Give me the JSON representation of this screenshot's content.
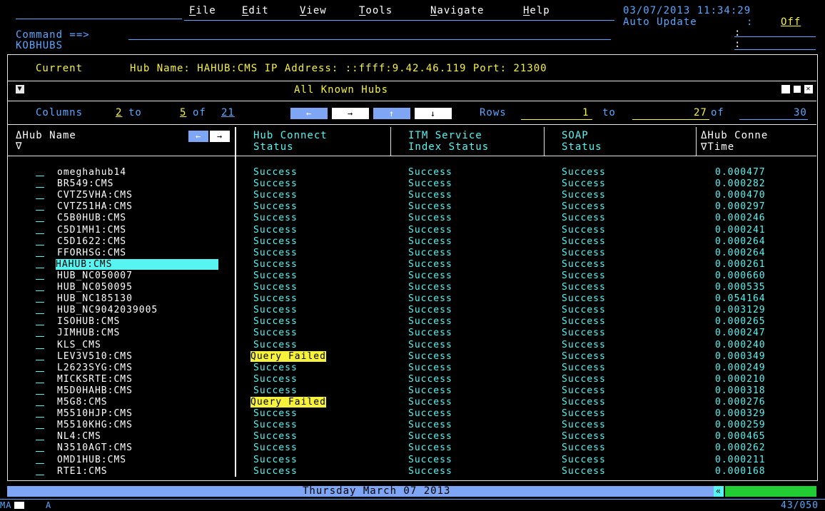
{
  "menu": {
    "items": [
      {
        "label": "File",
        "u": "F"
      },
      {
        "label": "Edit",
        "u": "E"
      },
      {
        "label": "View",
        "u": "V"
      },
      {
        "label": "Tools",
        "u": "T"
      },
      {
        "label": "Navigate",
        "u": "N"
      },
      {
        "label": "Help",
        "u": "H"
      }
    ],
    "datetime": "03/07/2013 11:34:29",
    "auto_update_label": "Auto Update",
    "auto_update_sep": ":",
    "auto_update_value": "Off",
    "colon": ":"
  },
  "command": {
    "label": "Command ==>",
    "value": ""
  },
  "panel_id": "KOBHUBS",
  "current": {
    "label": "Current",
    "text": "Hub Name: HAHUB:CMS IP Address: ::ffff:9.42.46.119 Port: 21300"
  },
  "window": {
    "title": "All Known Hubs",
    "columns_label": "Columns",
    "col_from": "2",
    "col_to_label": "to",
    "col_to": "5",
    "col_of_label": "of",
    "col_total": "21",
    "rows_label": "Rows",
    "row_from": "1",
    "row_to_label": "to",
    "row_to": "27",
    "row_of_label": "of",
    "row_total": "30",
    "left_arrow": "←",
    "right_arrow": "→",
    "up_arrow": "↑",
    "down_arrow": "↓"
  },
  "headers": {
    "hub_name": "ΔHub Name",
    "hub_name_sort": "∇",
    "hub_connect_1": "Hub Connect",
    "hub_connect_2": "Status",
    "itm_1": "ITM Service",
    "itm_2": "Index Status",
    "soap_1": "SOAP",
    "soap_2": "Status",
    "time_1": "ΔHub Conne",
    "time_2": "∇Time"
  },
  "rows": [
    {
      "name": "omeghahub14",
      "connect": "Success",
      "itm": "Success",
      "soap": "Success",
      "time": "0.000477"
    },
    {
      "name": "BR549:CMS",
      "connect": "Success",
      "itm": "Success",
      "soap": "Success",
      "time": "0.000282"
    },
    {
      "name": "CVTZ5VHA:CMS",
      "connect": "Success",
      "itm": "Success",
      "soap": "Success",
      "time": "0.000470"
    },
    {
      "name": "CVTZ51HA:CMS",
      "connect": "Success",
      "itm": "Success",
      "soap": "Success",
      "time": "0.000297"
    },
    {
      "name": "C5B0HUB:CMS",
      "connect": "Success",
      "itm": "Success",
      "soap": "Success",
      "time": "0.000246"
    },
    {
      "name": "C5D1MH1:CMS",
      "connect": "Success",
      "itm": "Success",
      "soap": "Success",
      "time": "0.000241"
    },
    {
      "name": "C5D1622:CMS",
      "connect": "Success",
      "itm": "Success",
      "soap": "Success",
      "time": "0.000264"
    },
    {
      "name": "FFORHSG:CMS",
      "connect": "Success",
      "itm": "Success",
      "soap": "Success",
      "time": "0.000264"
    },
    {
      "name": "HAHUB:CMS",
      "connect": "Success",
      "itm": "Success",
      "soap": "Success",
      "time": "0.000261",
      "selected": true
    },
    {
      "name": "HUB_NC050007",
      "connect": "Success",
      "itm": "Success",
      "soap": "Success",
      "time": "0.000660"
    },
    {
      "name": "HUB_NC050095",
      "connect": "Success",
      "itm": "Success",
      "soap": "Success",
      "time": "0.000535"
    },
    {
      "name": "HUB_NC185130",
      "connect": "Success",
      "itm": "Success",
      "soap": "Success",
      "time": "0.054164"
    },
    {
      "name": "HUB_NC9042039005",
      "connect": "Success",
      "itm": "Success",
      "soap": "Success",
      "time": "0.003129"
    },
    {
      "name": "ISOHUB:CMS",
      "connect": "Success",
      "itm": "Success",
      "soap": "Success",
      "time": "0.000265"
    },
    {
      "name": "JIMHUB:CMS",
      "connect": "Success",
      "itm": "Success",
      "soap": "Success",
      "time": "0.000247"
    },
    {
      "name": "KLS_CMS",
      "connect": "Success",
      "itm": "Success",
      "soap": "Success",
      "time": "0.000240"
    },
    {
      "name": "LEV3V510:CMS",
      "connect": "Query Failed",
      "itm": "Success",
      "soap": "Success",
      "time": "0.000349",
      "failed": true
    },
    {
      "name": "L2623SYG:CMS",
      "connect": "Success",
      "itm": "Success",
      "soap": "Success",
      "time": "0.000249"
    },
    {
      "name": "MICKSRTE:CMS",
      "connect": "Success",
      "itm": "Success",
      "soap": "Success",
      "time": "0.000210"
    },
    {
      "name": "M5D0HAHB:CMS",
      "connect": "Success",
      "itm": "Success",
      "soap": "Success",
      "time": "0.000318"
    },
    {
      "name": "M5G8:CMS",
      "connect": "Query Failed",
      "itm": "Success",
      "soap": "Success",
      "time": "0.000276",
      "failed": true
    },
    {
      "name": "M5510HJP:CMS",
      "connect": "Success",
      "itm": "Success",
      "soap": "Success",
      "time": "0.000329"
    },
    {
      "name": "M5510KHG:CMS",
      "connect": "Success",
      "itm": "Success",
      "soap": "Success",
      "time": "0.000259"
    },
    {
      "name": "NL4:CMS",
      "connect": "Success",
      "itm": "Success",
      "soap": "Success",
      "time": "0.000465"
    },
    {
      "name": "N3510AGT:CMS",
      "connect": "Success",
      "itm": "Success",
      "soap": "Success",
      "time": "0.000262"
    },
    {
      "name": "OMD1HUB:CMS",
      "connect": "Success",
      "itm": "Success",
      "soap": "Success",
      "time": "0.000211"
    },
    {
      "name": "RTE1:CMS",
      "connect": "Success",
      "itm": "Success",
      "soap": "Success",
      "time": "0.000168"
    }
  ],
  "footer": {
    "date": "Thursday March 07 2013",
    "scroll_glyph": "«",
    "oia_left": "MA",
    "oia_mode": "A",
    "cursor_pos": "43/050"
  },
  "colors": {
    "cyan": "#57f5f2",
    "blue": "#5aa7ff",
    "yellow": "#f6f23c",
    "status_bar": "#7ea6f5",
    "green": "#22cc33"
  }
}
